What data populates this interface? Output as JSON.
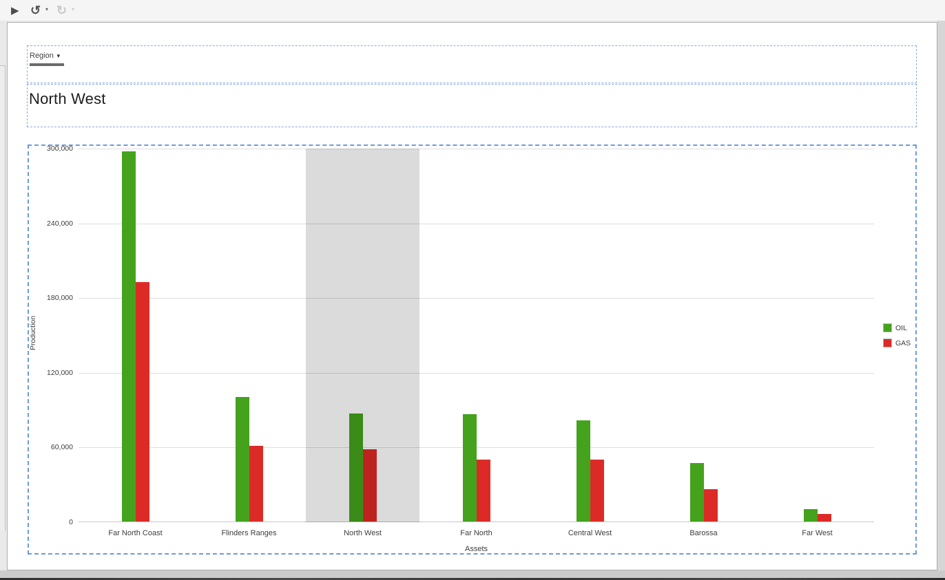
{
  "toolbar": {
    "play_icon": "play-icon",
    "undo_icon": "undo-icon",
    "redo_icon": "redo-icon"
  },
  "parameter_panel": {
    "label": "Region"
  },
  "title_textbox": {
    "text": "North West"
  },
  "chart_data": {
    "type": "bar",
    "title": "",
    "xlabel": "Assets",
    "ylabel": "Production",
    "categories": [
      "Far North Coast",
      "Flinders Ranges",
      "North West",
      "Far North",
      "Central West",
      "Barossa",
      "Far West"
    ],
    "series": [
      {
        "name": "OIL",
        "color": "#44A21D",
        "values": [
          297000,
          100000,
          87000,
          86000,
          81000,
          47000,
          10000
        ]
      },
      {
        "name": "GAS",
        "color": "#DC2B26",
        "values": [
          192000,
          61000,
          58000,
          50000,
          50000,
          26000,
          6000
        ]
      }
    ],
    "ylim": [
      0,
      300000
    ],
    "y_ticks": [
      {
        "value": 0,
        "label": "0"
      },
      {
        "value": 60000,
        "label": "60,000"
      },
      {
        "value": 120000,
        "label": "120,000"
      },
      {
        "value": 180000,
        "label": "180,000"
      },
      {
        "value": 240000,
        "label": "240,000"
      },
      {
        "value": 300000,
        "label": "300,000"
      }
    ],
    "grid": true,
    "legend_position": "right",
    "highlighted_category": "North West",
    "highlight_overlay_color": "rgba(0,0,0,0.14)"
  }
}
